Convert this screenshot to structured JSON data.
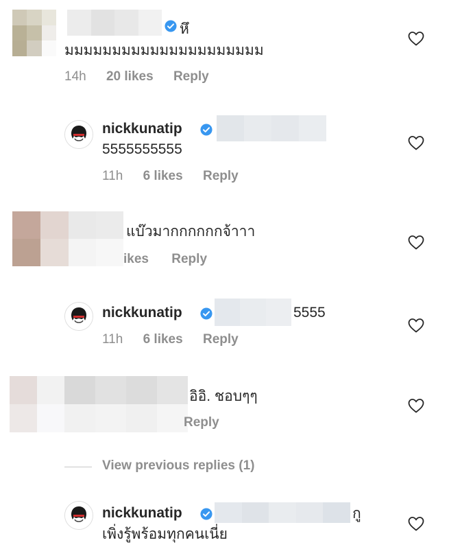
{
  "comments": [
    {
      "text_line1": "หึ",
      "text_line2": "มมมมมมมมมมมมมมมมมมมมม",
      "time": "14h",
      "likes": "20 likes",
      "reply": "Reply"
    },
    {
      "username": "nickkunatip",
      "text": "5555555555",
      "time": "11h",
      "likes": "6 likes",
      "reply": "Reply"
    },
    {
      "text": "แบ๊วมากกกกกกจ้าาา",
      "likes_fragment": "ikes",
      "reply": "Reply"
    },
    {
      "username": "nickkunatip",
      "text": "5555",
      "time": "11h",
      "likes": "6 likes",
      "reply": "Reply"
    },
    {
      "text": "อิอิ. ชอบๆๆ",
      "reply_fragment": "Reply"
    },
    {
      "username": "nickkunatip",
      "text_line1": "กู",
      "text_line2": "เพิ่งรู้พร้อมทุกคนเนี่ย"
    }
  ],
  "view_previous": "View previous replies (1)",
  "colors": {
    "verified": "#3897f0",
    "meta": "#8e8e8e",
    "text": "#262626"
  }
}
